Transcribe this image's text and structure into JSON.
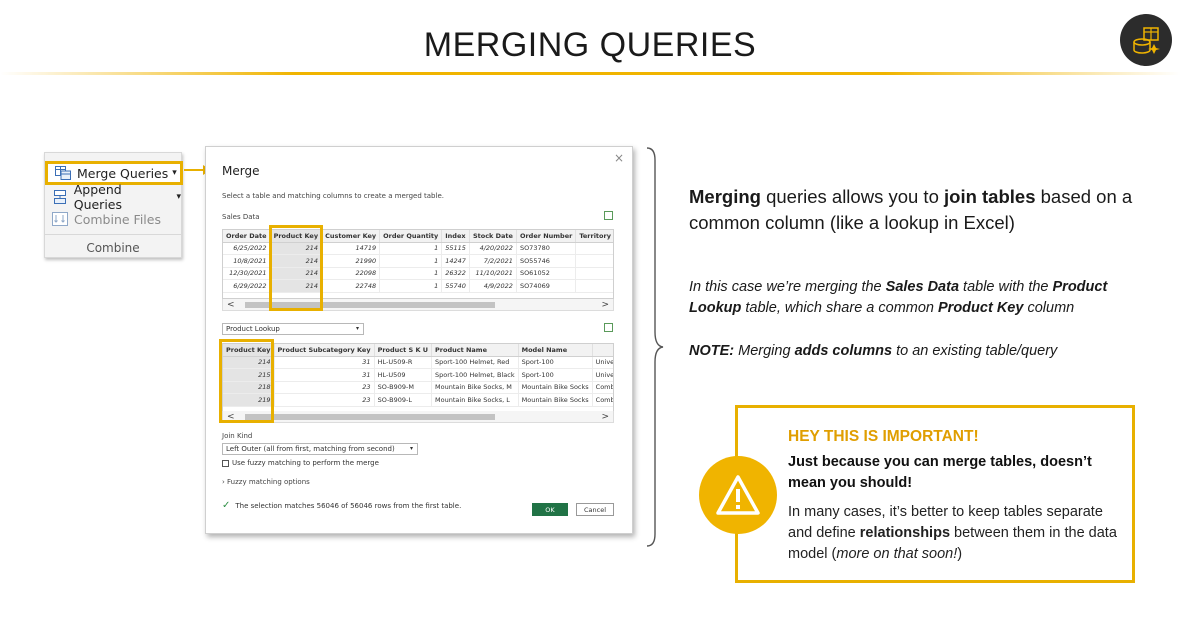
{
  "page": {
    "title": "MERGING QUERIES"
  },
  "ribbon": {
    "merge_label": "Merge Queries",
    "merge_caret": "▾",
    "append_label": "Append Queries",
    "append_caret": "▾",
    "combine_files_label": "Combine Files",
    "group_label": "Combine"
  },
  "dialog": {
    "close": "×",
    "title": "Merge",
    "subtitle": "Select a table and matching columns to create a merged table.",
    "top_table_label": "Sales Data",
    "top_columns": [
      "Order Date",
      "Product Key",
      "Customer Key",
      "Order Quantity",
      "Index",
      "Stock Date",
      "Order Number",
      "Territory"
    ],
    "top_rows": [
      [
        "6/25/2022",
        "214",
        "14719",
        "1",
        "55115",
        "4/20/2022",
        "SO73780",
        ""
      ],
      [
        "10/8/2021",
        "214",
        "21990",
        "1",
        "14247",
        "7/2/2021",
        "SO55746",
        ""
      ],
      [
        "12/30/2021",
        "214",
        "22098",
        "1",
        "26322",
        "11/10/2021",
        "SO61052",
        ""
      ],
      [
        "6/29/2022",
        "214",
        "22748",
        "1",
        "55740",
        "4/9/2022",
        "SO74069",
        ""
      ]
    ],
    "bottom_table_select": "Product Lookup",
    "bottom_columns": [
      "Product Key",
      "Product Subcategory Key",
      "Product S K U",
      "Product Name",
      "Model Name",
      ""
    ],
    "bottom_rows": [
      [
        "214",
        "31",
        "HL-U509-R",
        "Sport-100 Helmet, Red",
        "Sport-100",
        "Universal fit, w"
      ],
      [
        "215",
        "31",
        "HL-U509",
        "Sport-100 Helmet, Black",
        "Sport-100",
        "Universal fit, w"
      ],
      [
        "218",
        "23",
        "SO-B909-M",
        "Mountain Bike Socks, M",
        "Mountain Bike Socks",
        "Combination c"
      ],
      [
        "219",
        "23",
        "SO-B909-L",
        "Mountain Bike Socks, L",
        "Mountain Bike Socks",
        "Combination c"
      ]
    ],
    "scroll_left": "<",
    "scroll_right": ">",
    "join_kind_label": "Join Kind",
    "join_kind_value": "Left Outer (all from first, matching from second)",
    "fuzzy_checkbox_label": "Use fuzzy matching to perform the merge",
    "fuzzy_options": "› Fuzzy matching options",
    "status_text": "The selection matches 56046 of 56046 rows from the first table.",
    "ok": "OK",
    "cancel": "Cancel"
  },
  "description": {
    "line_part1_bold": "Merging",
    "line_part2": " queries allows you to ",
    "line_part3_bold": "join tables",
    "line_part4": " based on a common column (like a lookup in Excel)"
  },
  "note1": {
    "p1": "In this case we’re merging the ",
    "b1": "Sales Data",
    "p2": " table with the ",
    "b2": "Product Lookup",
    "p3": " table, which share a common ",
    "b3": "Product Key",
    "p4": " column"
  },
  "note2": {
    "b1": "NOTE:",
    "p1": " Merging ",
    "b2": "adds columns",
    "p2": " to an existing table/query"
  },
  "callout": {
    "title": "HEY THIS IS IMPORTANT!",
    "headline": "Just because you can merge tables, doesn’t mean you should!",
    "body_p1": "In many cases, it’s better to keep tables separate and define ",
    "body_b1": "relationships",
    "body_p2": " between them in the data model (",
    "body_i1": "more on that soon!",
    "body_p3": ")"
  },
  "colors": {
    "accent": "#f0b400",
    "ok_button": "#217346"
  },
  "icons": [
    "logo-icon",
    "merge-queries-icon",
    "append-queries-icon",
    "combine-files-icon",
    "warning-icon",
    "check-icon"
  ]
}
